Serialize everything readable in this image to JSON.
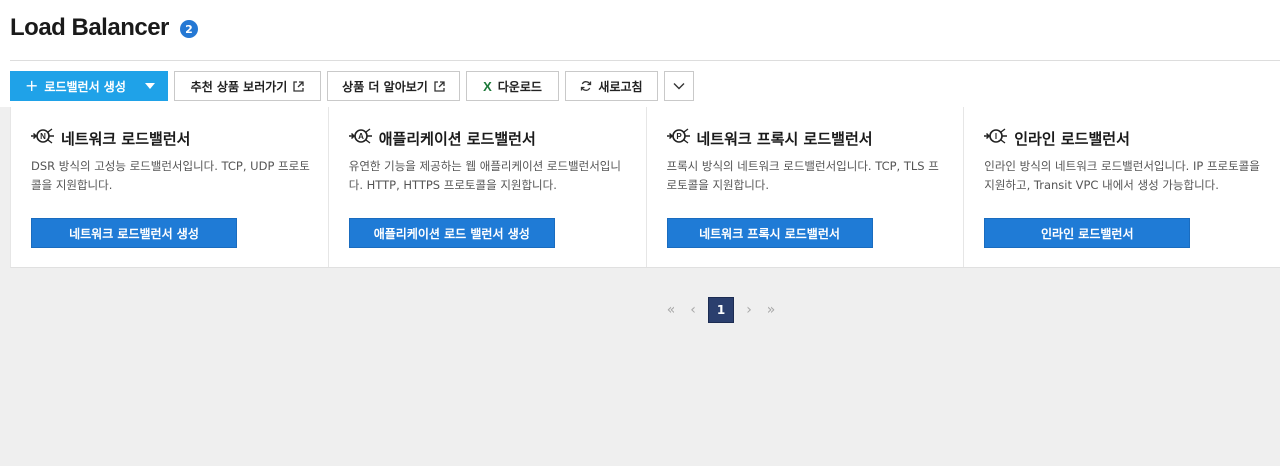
{
  "header": {
    "title": "Load Balancer",
    "count_badge": "2"
  },
  "toolbar": {
    "create_label": "로드밸런서 생성",
    "recommend_label": "추천 상품 보러가기",
    "learn_more_label": "상품 더 알아보기",
    "download_label": "다운로드",
    "refresh_label": "새로고침"
  },
  "cards": [
    {
      "icon_letter": "N",
      "title": "네트워크 로드밸런서",
      "desc": "DSR 방식의 고성능 로드밸런서입니다. TCP, UDP 프로토콜을 지원합니다.",
      "button": "네트워크 로드밸런서 생성"
    },
    {
      "icon_letter": "A",
      "title": "애플리케이션 로드밸런서",
      "desc": "유연한 기능을 제공하는 웹 애플리케이션 로드밸런서입니다. HTTP, HTTPS 프로토콜을 지원합니다.",
      "button": "애플리케이션 로드 밸런서 생성"
    },
    {
      "icon_letter": "P",
      "title": "네트워크 프록시 로드밸런서",
      "desc": "프록시 방식의 네트워크 로드밸런서입니다. TCP, TLS 프로토콜을 지원합니다.",
      "button": "네트워크 프록시 로드밸런서"
    },
    {
      "icon_letter": "I",
      "title": "인라인 로드밸런서",
      "desc": "인라인 방식의 네트워크 로드밸런서입니다. IP 프로토콜을 지원하고, Transit VPC 내에서 생성 가능합니다.",
      "button": "인라인 로드밸런서"
    }
  ],
  "pagination": {
    "current": "1",
    "first": "«",
    "prev": "‹",
    "next": "›",
    "last": "»"
  },
  "colors": {
    "primary": "#1fa2e8",
    "card_button": "#1f7bd6",
    "pager_current": "#2b3f6e",
    "excel": "#1d7a3a"
  }
}
